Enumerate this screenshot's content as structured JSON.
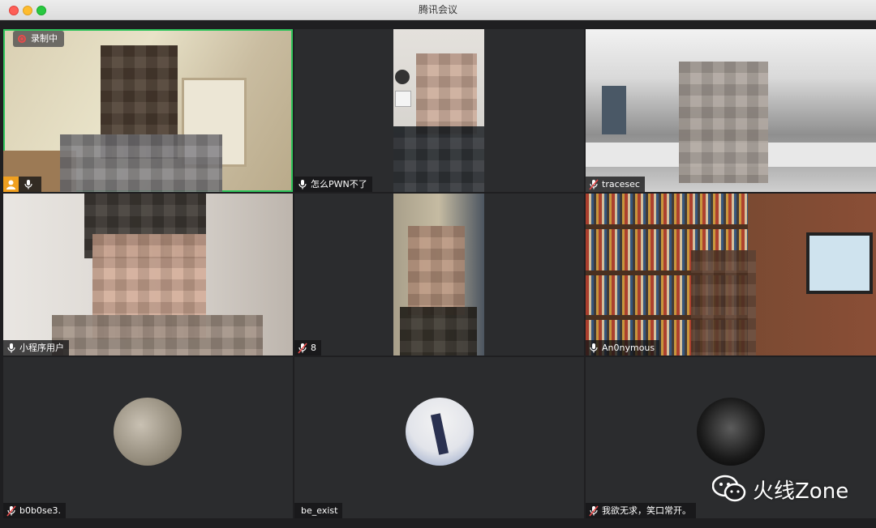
{
  "window": {
    "title": "腾讯会议"
  },
  "recording": {
    "label": "录制中"
  },
  "participants": [
    {
      "name": "",
      "muted": false,
      "video": true
    },
    {
      "name": "怎么PWN不了",
      "muted": false,
      "video": true
    },
    {
      "name": "tracesec",
      "muted": true,
      "video": true
    },
    {
      "name": "小程序用户",
      "muted": false,
      "video": true
    },
    {
      "name": "8",
      "muted": true,
      "video": true
    },
    {
      "name": "An0nymous",
      "muted": false,
      "video": true
    },
    {
      "name": "b0b0se3.",
      "muted": true,
      "video": false
    },
    {
      "name": "be_exist",
      "muted": false,
      "video": false
    },
    {
      "name": "我欲无求，笑口常开。",
      "muted": true,
      "video": false
    }
  ],
  "watermark": {
    "text": "火线Zone"
  },
  "colors": {
    "active_speaker_border": "#2fc45b",
    "tile_bg": "#2b2c2e",
    "muted_icon": "#e94a4a"
  }
}
